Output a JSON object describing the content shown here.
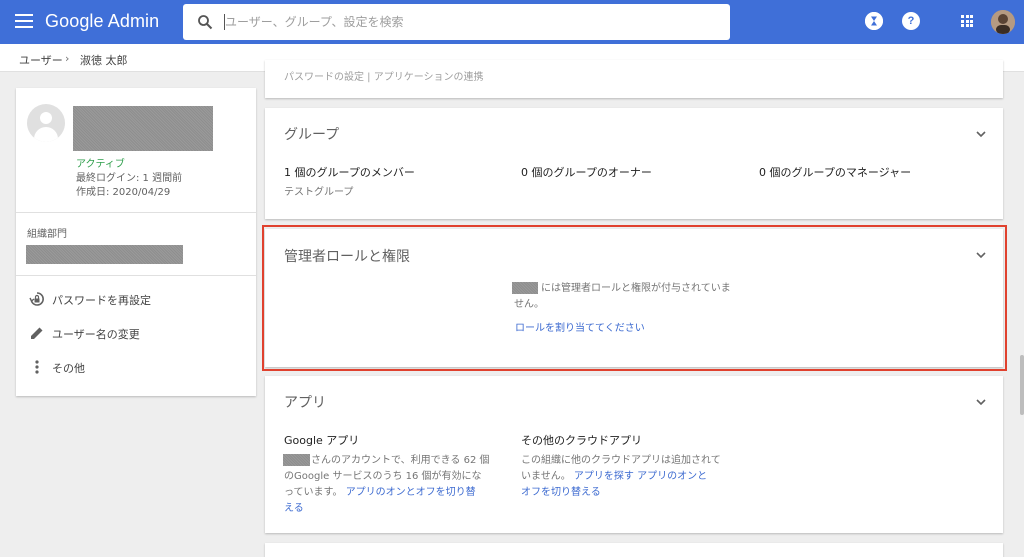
{
  "topbar": {
    "brand": "Google Admin",
    "search_placeholder": "ユーザー、グループ、設定を検索",
    "help_glyph": "?"
  },
  "breadcrumb": {
    "parent": "ユーザー",
    "separator": "›",
    "current": "淑徳 太郎"
  },
  "profile": {
    "status": "アクティブ",
    "last_login": "最終ログイン: 1 週間前",
    "created": "作成日: 2020/04/29",
    "org_unit_label": "組織部門",
    "actions": [
      {
        "label": "パスワードを再設定",
        "icon": "lock-reset-icon"
      },
      {
        "label": "ユーザー名の変更",
        "icon": "pencil-icon"
      },
      {
        "label": "その他",
        "icon": "more-vert-icon"
      }
    ]
  },
  "security_card": {
    "links_text": "パスワードの設定 | アプリケーションの連携"
  },
  "groups_card": {
    "title": "グループ",
    "member": "1 個のグループのメンバー",
    "owner": "0 個のグループのオーナー",
    "manager": "0 個のグループのマネージャー",
    "group_name": "テストグループ"
  },
  "admin_card": {
    "title": "管理者ロールと権限",
    "message_line1": "には管理者ロールと権限が付与されていま",
    "message_line2": "せん。",
    "assign_link": "ロールを割り当ててください"
  },
  "apps_card": {
    "title": "アプリ",
    "google_apps_head": "Google アプリ",
    "google_apps_line1": "さんのアカウントで、利用できる 62 個",
    "google_apps_line2": "のGoogle サービスのうち 16 個が有効にな",
    "google_apps_line3_text": "っています。",
    "google_apps_link_part1": "アプリのオンとオフを切り替",
    "google_apps_link_part2": "える",
    "cloud_apps_head": "その他のクラウドアプリ",
    "cloud_apps_line1": "この組織に他のクラウドアプリは追加されて",
    "cloud_apps_line2_text": "いません。",
    "cloud_apps_link1": "アプリを探す",
    "cloud_apps_link2_part1": "アプリのオンと",
    "cloud_apps_link2_part2": "オフを切り替える"
  },
  "colors": {
    "topbar": "#3f6fd8",
    "link": "#3c6ad0",
    "active_status": "#2e9e4b",
    "highlight_border": "#e0412e"
  }
}
